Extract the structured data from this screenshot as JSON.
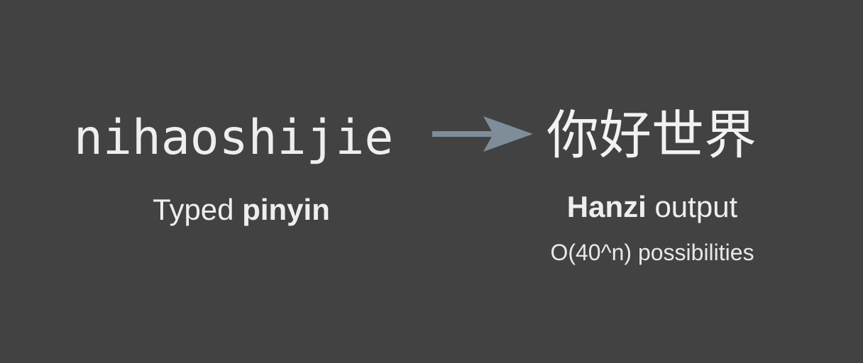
{
  "input": {
    "pinyin_text": "nihaoshijie",
    "caption_plain": "Typed ",
    "caption_bold": "pinyin"
  },
  "output": {
    "hanzi_text": "你好世界",
    "caption_bold": "Hanzi",
    "caption_plain": " output",
    "complexity": "O(40^n) possibilities"
  },
  "colors": {
    "background": "#424242",
    "text": "#eeeeee",
    "arrow": "#7e8d99"
  },
  "icons": {
    "arrow": "right-arrow-icon"
  }
}
